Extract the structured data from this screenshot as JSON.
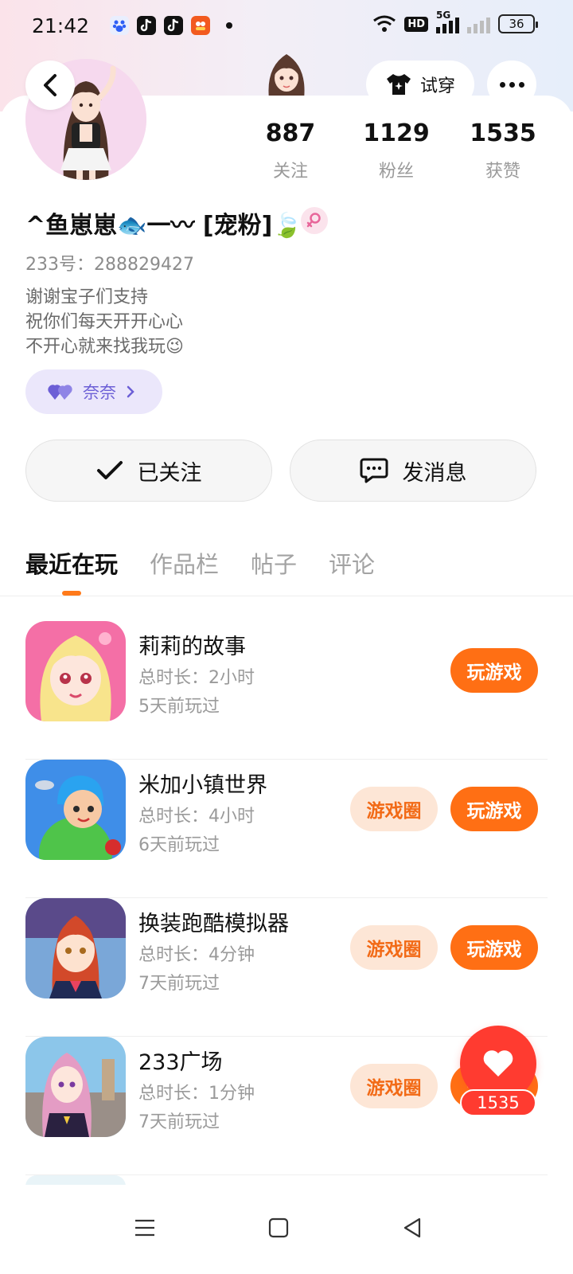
{
  "status_bar": {
    "time": "21:42",
    "network": "5G",
    "hd_label": "HD",
    "battery": "36",
    "notification_icons": [
      "baidu-icon",
      "douyin-icon",
      "douyin-icon",
      "app-icon"
    ]
  },
  "header": {
    "tryon_label": "试穿",
    "icons": [
      "back-arrow-icon",
      "tshirt-icon",
      "more-dots-icon"
    ]
  },
  "profile": {
    "stats": [
      {
        "value": "887",
        "label": "关注"
      },
      {
        "value": "1129",
        "label": "粉丝"
      },
      {
        "value": "1535",
        "label": "获赞"
      }
    ],
    "nickname": "^鱼崽崽🐟一〰 [宠粉]🍃",
    "id_text": "233号：288829427",
    "bio": [
      "谢谢宝子们支持",
      "祝你们每天开开心心",
      "不开心就来找我玩😉"
    ],
    "friend_tag": "奈奈"
  },
  "actions": {
    "follow_label": "已关注",
    "message_label": "发消息"
  },
  "tabs": [
    {
      "label": "最近在玩",
      "active": true
    },
    {
      "label": "作品栏",
      "active": false
    },
    {
      "label": "帖子",
      "active": false
    },
    {
      "label": "评论",
      "active": false
    }
  ],
  "games": [
    {
      "title": "莉莉的故事",
      "duration": "总时长：2小时",
      "last_played": "5天前玩过",
      "has_circle": false
    },
    {
      "title": "米加小镇世界",
      "duration": "总时长：4小时",
      "last_played": "6天前玩过",
      "has_circle": true
    },
    {
      "title": "换装跑酷模拟器",
      "duration": "总时长：4分钟",
      "last_played": "7天前玩过",
      "has_circle": true
    },
    {
      "title": "233广场",
      "duration": "总时长：1分钟",
      "last_played": "7天前玩过",
      "has_circle": true
    }
  ],
  "buttons": {
    "circle_label": "游戏圈",
    "play_label": "玩游戏"
  },
  "like_fab": {
    "count": "1535"
  },
  "colors": {
    "accent_orange": "#ff6f14",
    "accent_light_orange": "#fde6d6",
    "like_red": "#ff3b30",
    "tag_purple": "#6c5fd6"
  }
}
